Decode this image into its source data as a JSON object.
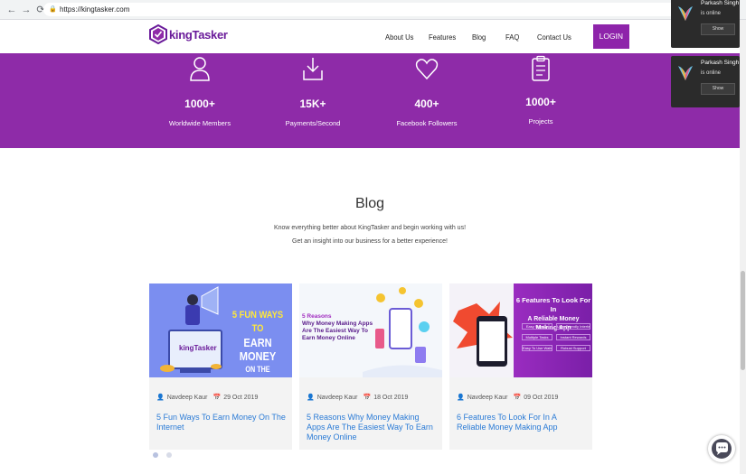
{
  "browser": {
    "url": "https://kingtasker.com"
  },
  "header": {
    "logo_text": "kingTasker",
    "nav": [
      "About Us",
      "Features",
      "Blog",
      "FAQ",
      "Contact Us"
    ],
    "login": "LOGIN"
  },
  "stats": [
    {
      "icon": "user-icon",
      "number": "1000+",
      "label": "Worldwide Members"
    },
    {
      "icon": "download-icon",
      "number": "15K+",
      "label": "Payments/Second"
    },
    {
      "icon": "heart-icon",
      "number": "400+",
      "label": "Facebook Followers"
    },
    {
      "icon": "clipboard-icon",
      "number": "1000+",
      "label": "Projects"
    }
  ],
  "blog": {
    "title": "Blog",
    "sub1": "Know everything better about KingTasker and begin working with us!",
    "sub2": "Get an insight into our business for a better experience!",
    "cards": [
      {
        "img_lines": [
          "5 FUN WAYS TO",
          "EARN MONEY",
          "ON THE INTERNET"
        ],
        "img_logo": "kingTasker",
        "author": "Navdeep Kaur",
        "date": "29 Oct 2019",
        "title": "5 Fun Ways To Earn Money On The Internet"
      },
      {
        "img_lines": [
          "5 Reasons",
          "Why Money Making Apps",
          "Are The Easiest Way To",
          "Earn Money Online"
        ],
        "author": "Navdeep Kaur",
        "date": "18 Oct 2019",
        "title": "5 Reasons Why Money Making Apps Are The Easiest Way To Earn Money Online"
      },
      {
        "img_lines": [
          "6 Features To Look For In",
          "A Reliable Money Making App"
        ],
        "img_chips": [
          "Easy Sign Up",
          "User-Friendly Interface",
          "Multiple Tasks",
          "Instant Rewards",
          "Easy To Use Wallet Points",
          "Robust Support"
        ],
        "author": "Navdeep Kaur",
        "date": "09 Oct 2019",
        "title": "6 Features To Look For In A Reliable Money Making App"
      }
    ]
  },
  "notifications": [
    {
      "name": "Parkash Singh",
      "status": "is online",
      "button": "Show"
    },
    {
      "name": "Parkash Singh",
      "status": "is online",
      "button": "Show"
    }
  ],
  "colors": {
    "brand": "#8e2ba8",
    "link": "#2b7bd6"
  }
}
